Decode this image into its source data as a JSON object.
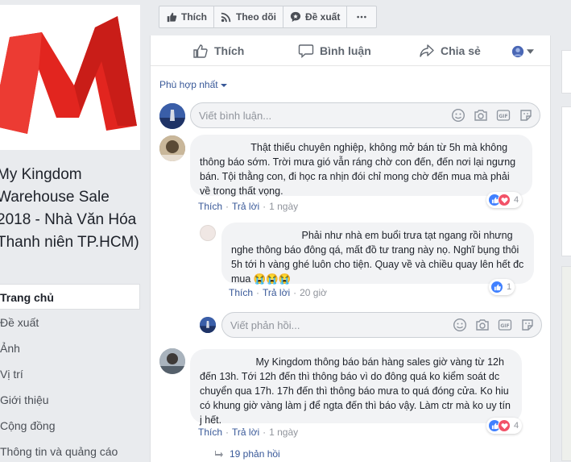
{
  "page": {
    "name": "My Kingdom Warehouse Sale 2018 - Nhà Văn Hóa Thanh niên TP.HCM)"
  },
  "nav": [
    {
      "label": "Trang chủ",
      "active": true
    },
    {
      "label": "Đề xuất"
    },
    {
      "label": "Ảnh"
    },
    {
      "label": "Vị trí"
    },
    {
      "label": "Giới thiệu"
    },
    {
      "label": "Cộng đồng"
    },
    {
      "label": "Thông tin và quảng cáo"
    }
  ],
  "top_actions": {
    "like": "Thích",
    "follow": "Theo dõi",
    "suggest": "Đề xuất",
    "more_icon": "ellipsis-icon"
  },
  "reaction_bar": {
    "like": "Thích",
    "comment": "Bình luận",
    "share": "Chia sẻ"
  },
  "sort_label": "Phù hợp nhất",
  "composer_placeholder": "Viết bình luận...",
  "reply_placeholder": "Viết phản hồi...",
  "comments": [
    {
      "text": "Thật thiếu chuyên nghiệp, không mở bán từ 5h mà không thông báo sớm. Trời mưa gió vẫn ráng chờ con đến, đến nơi lại ngưng bán. Tội thằng con, đi học ra nhịn đói chỉ mong chờ đến mua mà phải về trong thất vọng.",
      "like_label": "Thích",
      "reply_label": "Trả lời",
      "time": "1 ngày",
      "reaction_count": "4"
    },
    {
      "text": "Phải như nhà em buổi trưa tạt ngang rồi nhưng nghe thông báo đông qá, mất đồ tư trang này nọ. Nghĩ bụng thôi 5h tới h vàng ghé luôn cho tiện. Quay về và chiều quay lên hết đc mua 😭😭😭",
      "like_label": "Thích",
      "reply_label": "Trả lời",
      "time": "20 giờ",
      "reaction_count": "1"
    },
    {
      "text": "My Kingdom thông báo bán hàng sales giờ vàng từ 12h đến 13h. Tới 12h đến thì thông báo vì do đông quá ko kiểm soát dc chuyển qua 17h. 17h đến thì thông báo mưa to quá đóng cửa. Ko hiu có khung giờ vàng làm j để ngta đến thì báo vậy. Làm ctr mà ko uy tín j hết.",
      "like_label": "Thích",
      "reply_label": "Trả lời",
      "time": "1 ngày",
      "reaction_count": "4"
    }
  ],
  "replies_link": "19 phản hồi",
  "colors": {
    "brand_red": "#e2251f",
    "link_blue": "#385898",
    "like_blue": "#4080ff",
    "love_red": "#f25268"
  }
}
